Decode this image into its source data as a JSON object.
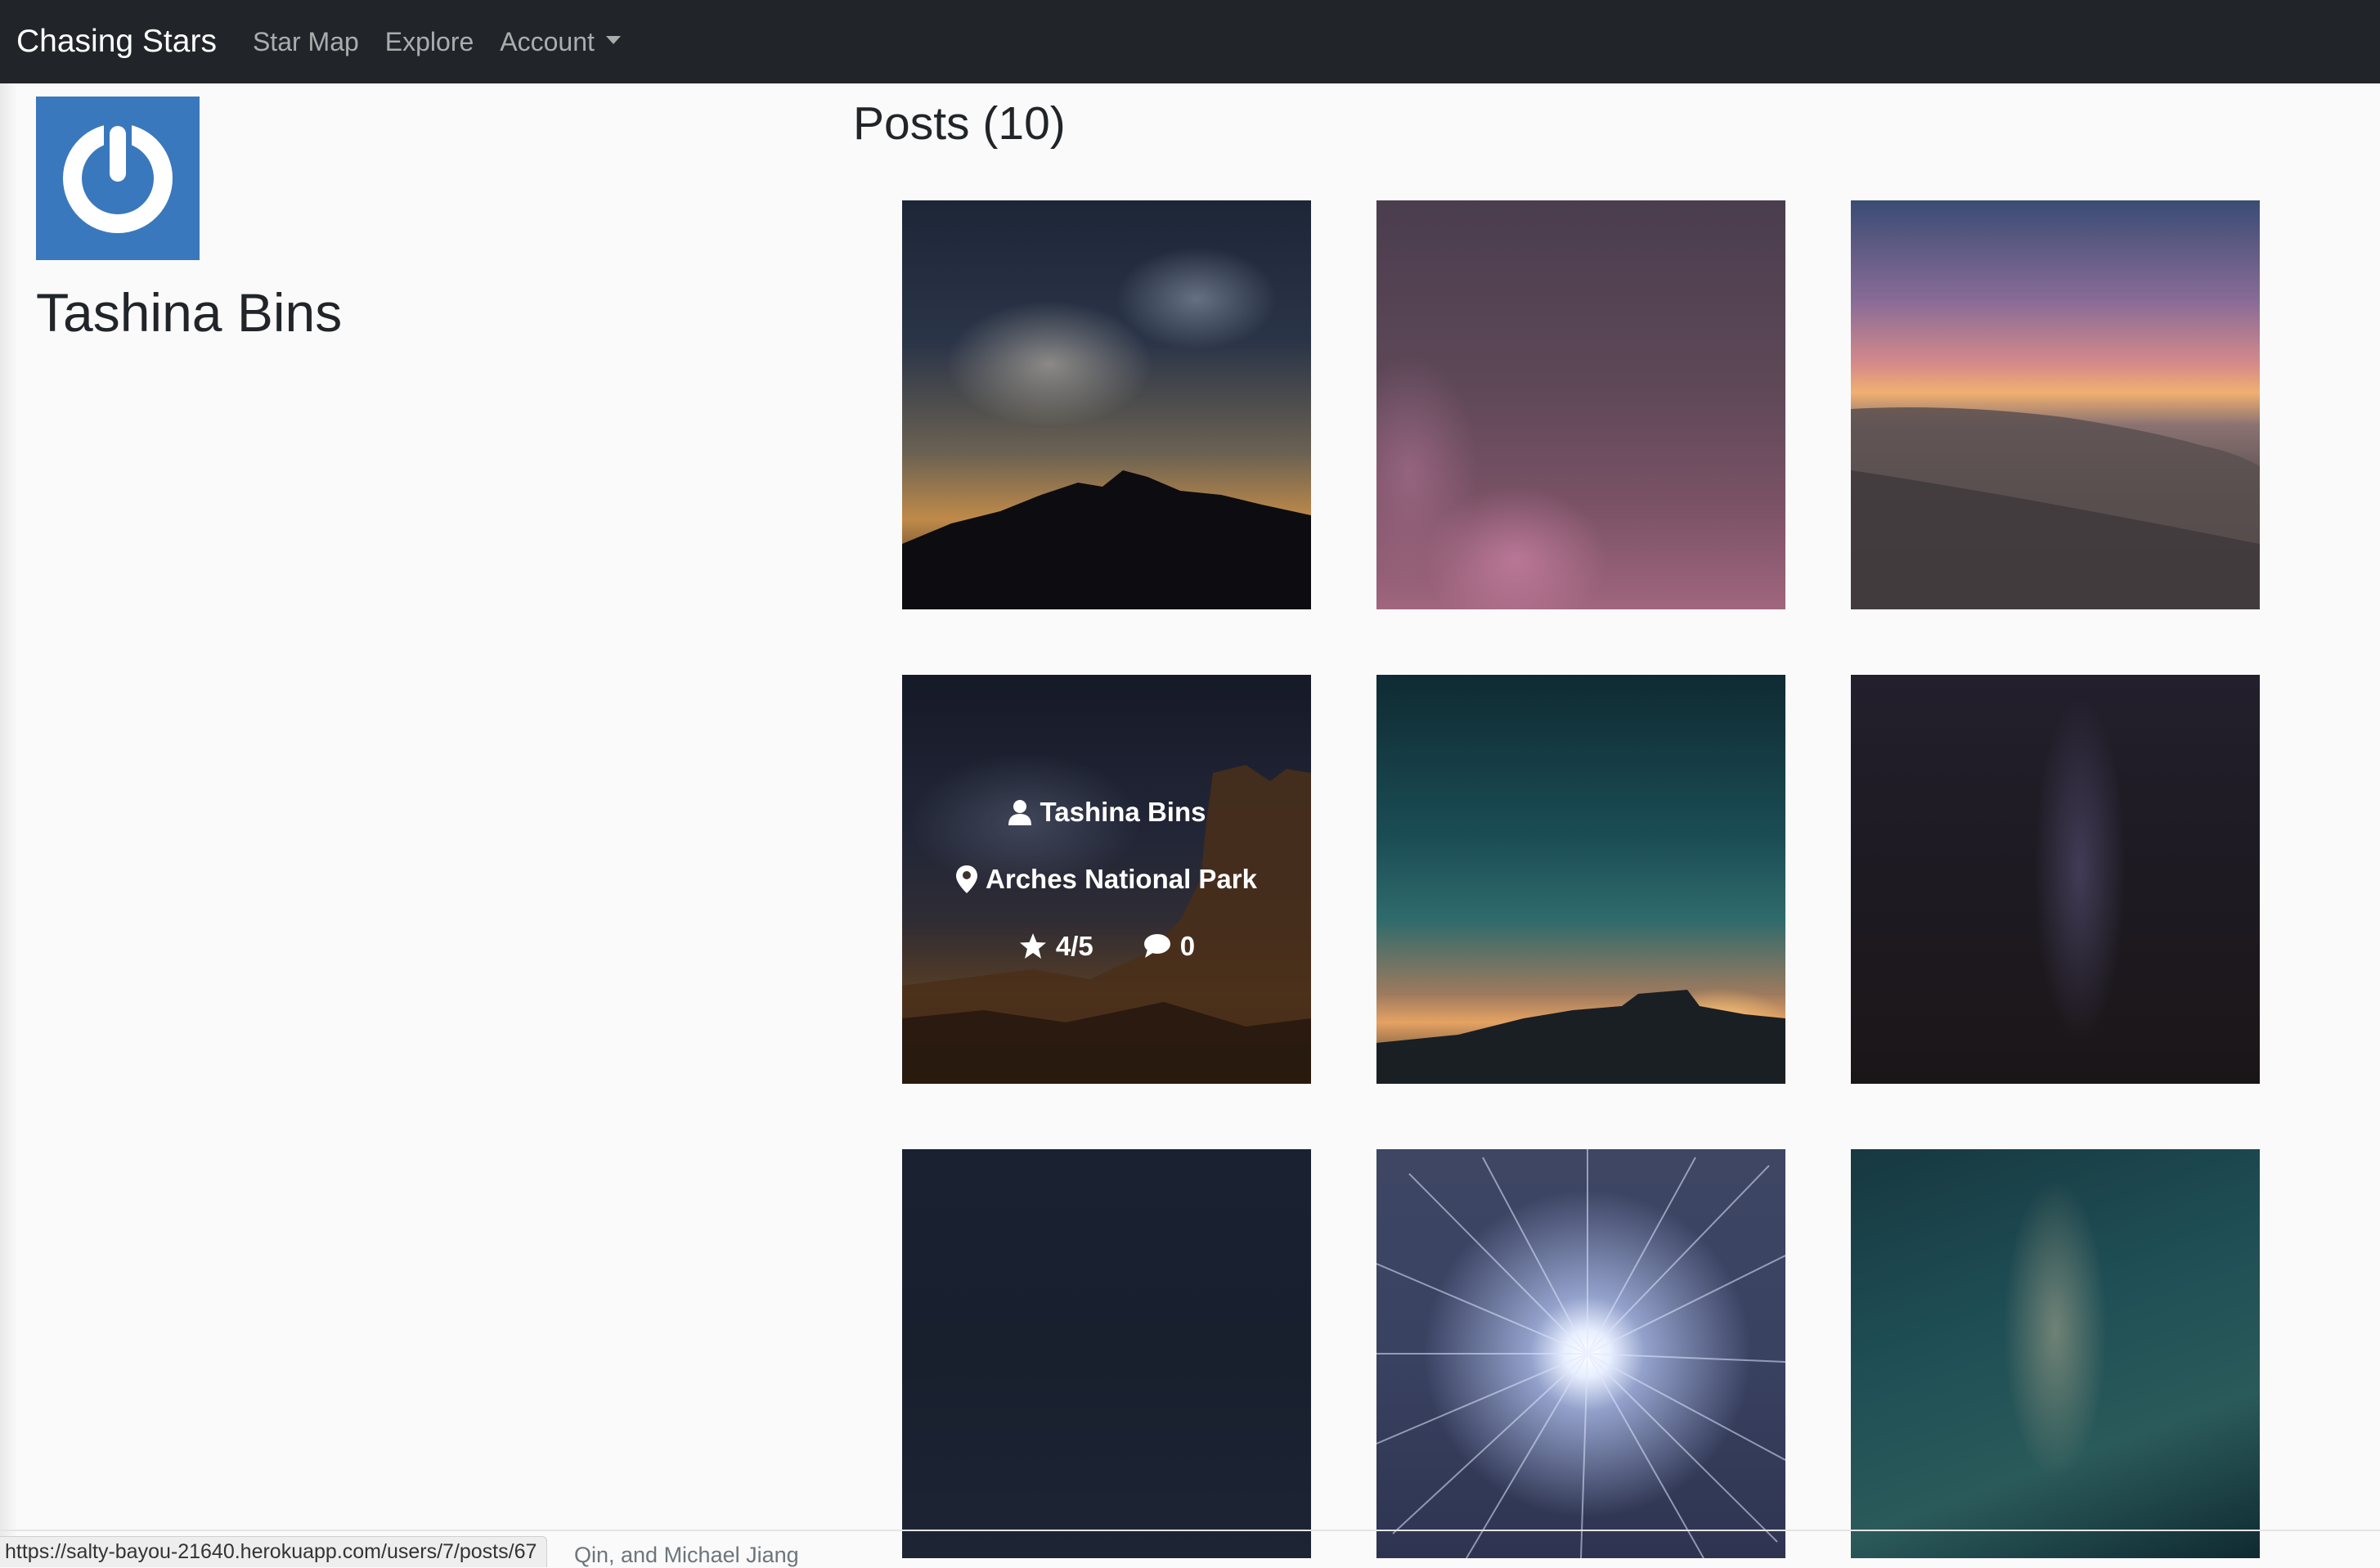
{
  "navbar": {
    "brand": "Chasing Stars",
    "links": [
      "Star Map",
      "Explore"
    ],
    "account_label": "Account",
    "background": "#212529"
  },
  "profile": {
    "name": "Tashina Bins",
    "avatar_icon": "power-icon",
    "avatar_color": "#3a78bd"
  },
  "posts": {
    "heading": "Posts (10)",
    "hovered": {
      "author": "Tashina Bins",
      "location": "Arches National Park",
      "rating": "4/5",
      "comments": "0"
    }
  },
  "footer": {
    "text": "Qin, and Michael Jiang"
  },
  "status_bar": {
    "url": "https://salty-bayou-21640.herokuapp.com/users/7/posts/67"
  }
}
